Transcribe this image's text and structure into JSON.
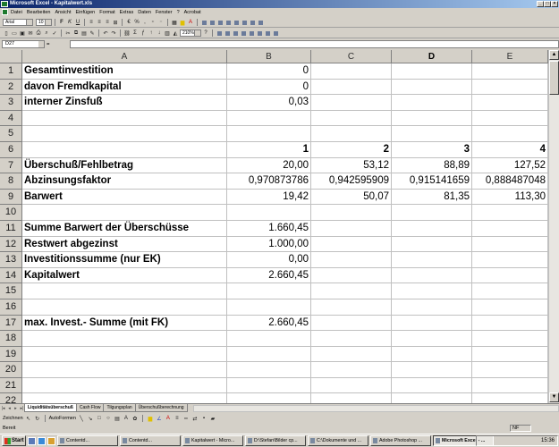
{
  "window": {
    "title": "Microsoft Excel - Kapitalwert.xls"
  },
  "menu": [
    "Datei",
    "Bearbeiten",
    "Ansicht",
    "Einfügen",
    "Format",
    "Extras",
    "Daten",
    "Fenster",
    "?",
    "Acrobat"
  ],
  "format_toolbar": {
    "font": "Arial",
    "size": "10",
    "zoom": "210%"
  },
  "name_box": "D27",
  "columns": [
    "A",
    "B",
    "C",
    "D",
    "E"
  ],
  "selected_column": "D",
  "rows": [
    {
      "n": "1",
      "a": "Gesamtinvestition",
      "b": "0",
      "c": "",
      "d": "",
      "e": ""
    },
    {
      "n": "2",
      "a": "davon Fremdkapital",
      "b": "0",
      "c": "",
      "d": "",
      "e": ""
    },
    {
      "n": "3",
      "a": "interner Zinsfuß",
      "b": "0,03",
      "c": "",
      "d": "",
      "e": ""
    },
    {
      "n": "4",
      "a": "",
      "b": "",
      "c": "",
      "d": "",
      "e": ""
    },
    {
      "n": "5",
      "a": "",
      "b": "",
      "c": "",
      "d": "",
      "e": ""
    },
    {
      "n": "6",
      "a": "",
      "b": "1",
      "c": "2",
      "d": "3",
      "e": "4"
    },
    {
      "n": "7",
      "a": "Überschuß/Fehlbetrag",
      "b": "20,00",
      "c": "53,12",
      "d": "88,89",
      "e": "127,52"
    },
    {
      "n": "8",
      "a": "Abzinsungsfaktor",
      "b": "0,970873786",
      "c": "0,942595909",
      "d": "0,915141659",
      "e": "0,888487048"
    },
    {
      "n": "9",
      "a": "Barwert",
      "b": "19,42",
      "c": "50,07",
      "d": "81,35",
      "e": "113,30"
    },
    {
      "n": "10",
      "a": "",
      "b": "",
      "c": "",
      "d": "",
      "e": ""
    },
    {
      "n": "11",
      "a": "Summe Barwert der Überschüsse",
      "b": "1.660,45",
      "c": "",
      "d": "",
      "e": ""
    },
    {
      "n": "12",
      "a": "Restwert abgezinst",
      "b": "1.000,00",
      "c": "",
      "d": "",
      "e": ""
    },
    {
      "n": "13",
      "a": "Investitionssumme (nur EK)",
      "b": "0,00",
      "c": "",
      "d": "",
      "e": ""
    },
    {
      "n": "14",
      "a": "Kapitalwert",
      "b": "2.660,45",
      "c": "",
      "d": "",
      "e": ""
    },
    {
      "n": "15",
      "a": "",
      "b": "",
      "c": "",
      "d": "",
      "e": ""
    },
    {
      "n": "16",
      "a": "",
      "b": "",
      "c": "",
      "d": "",
      "e": ""
    },
    {
      "n": "17",
      "a": "max. Invest.- Summe (mit FK)",
      "b": "2.660,45",
      "c": "",
      "d": "",
      "e": ""
    },
    {
      "n": "18",
      "a": "",
      "b": "",
      "c": "",
      "d": "",
      "e": ""
    },
    {
      "n": "19",
      "a": "",
      "b": "",
      "c": "",
      "d": "",
      "e": ""
    },
    {
      "n": "20",
      "a": "",
      "b": "",
      "c": "",
      "d": "",
      "e": ""
    },
    {
      "n": "21",
      "a": "",
      "b": "",
      "c": "",
      "d": "",
      "e": ""
    },
    {
      "n": "22",
      "a": "",
      "b": "",
      "c": "",
      "d": "",
      "e": ""
    }
  ],
  "sheet_tabs": [
    {
      "label": "Liquiditätsüberschuß",
      "active": true
    },
    {
      "label": "Cash Flow",
      "active": false
    },
    {
      "label": "Tilgungsplan",
      "active": false
    },
    {
      "label": "Überschußberechnung",
      "active": false
    }
  ],
  "drawing_toolbar": {
    "draw": "Zeichnen",
    "autoshapes": "AutoFormen"
  },
  "status": {
    "text": "Bereit",
    "nf": "NF"
  },
  "taskbar": {
    "start": "Start",
    "tasks": [
      {
        "label": "Contentd...",
        "active": false
      },
      {
        "label": "Contentd...",
        "active": false
      },
      {
        "label": "Kapitalwert - Micro...",
        "active": false
      },
      {
        "label": "D:\\Stefan\\Bilder cp...",
        "active": false
      },
      {
        "label": "C:\\Dokumente und ...",
        "active": false
      },
      {
        "label": "Adobe Photoshop ...",
        "active": false
      },
      {
        "label": "Microsoft Excel - ...",
        "active": true
      }
    ],
    "clock": "15:36"
  },
  "colors": {
    "title_start": "#0a246a",
    "title_end": "#a6caf0",
    "chrome": "#d4d0c8",
    "excel_green": "#1e7a2e"
  }
}
